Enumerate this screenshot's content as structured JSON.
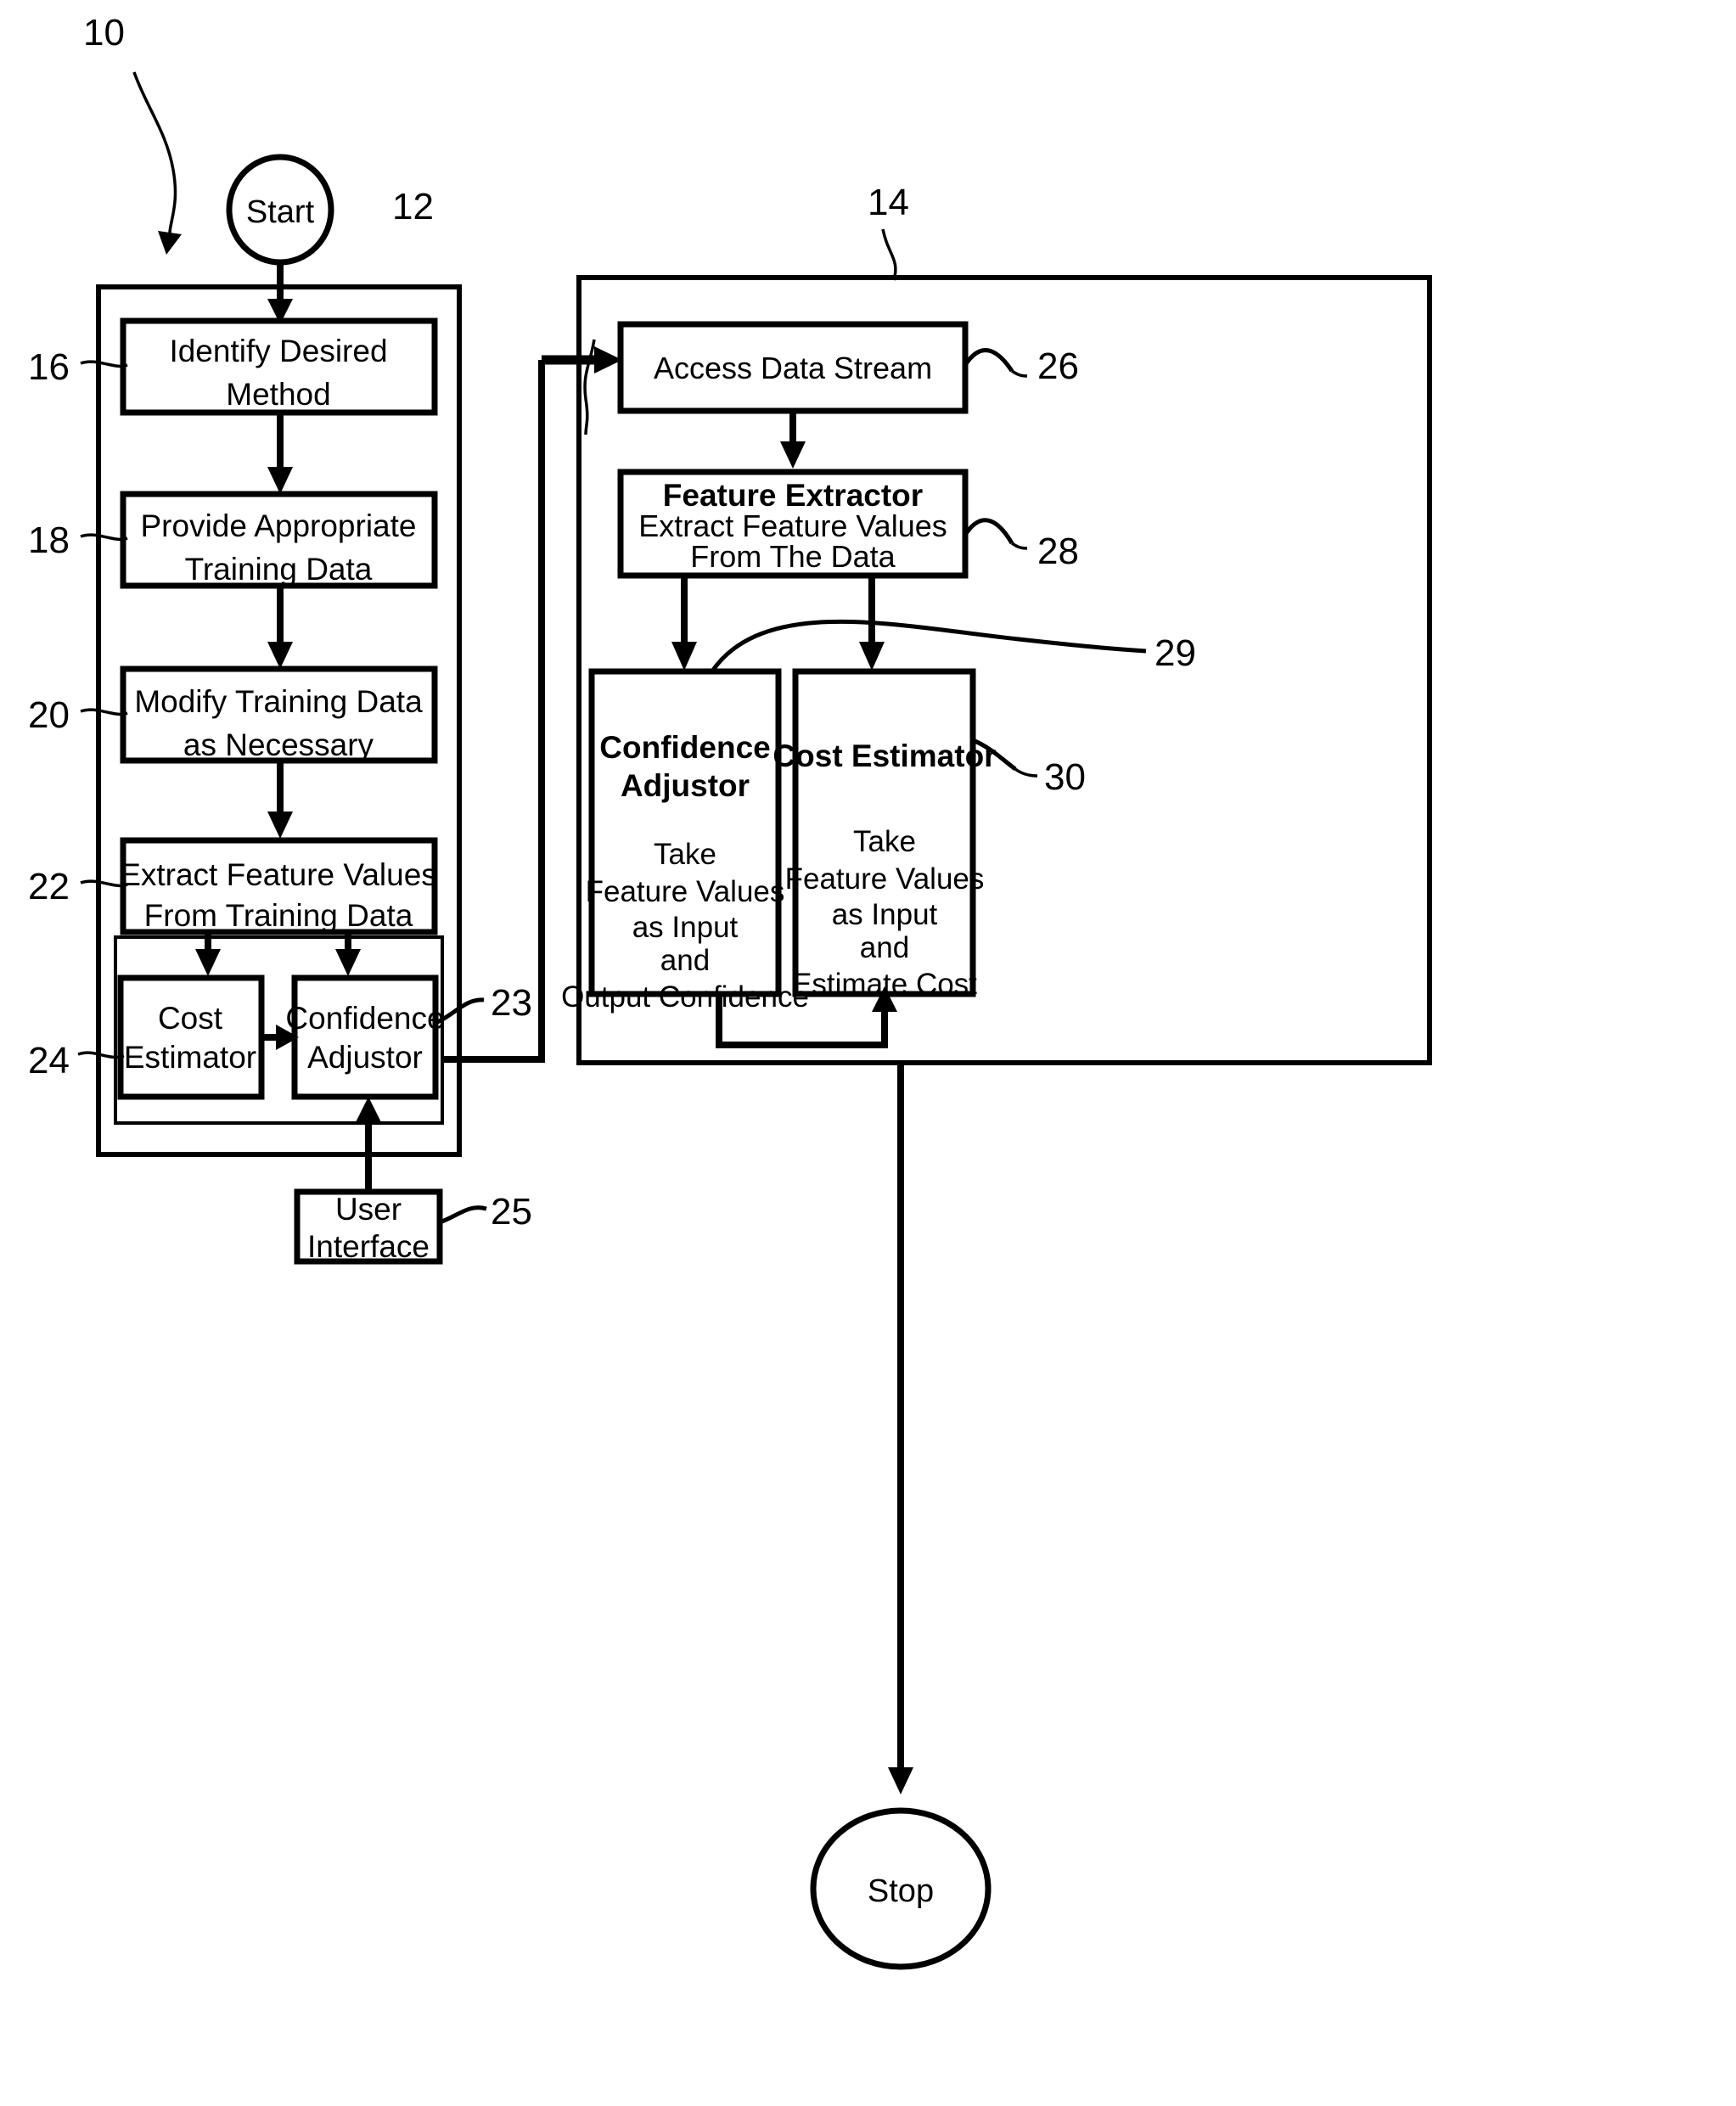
{
  "figure": {
    "type": "patent-flowchart",
    "figure_ref": "10",
    "background_color": "#ffffff",
    "line_color": "#000000"
  },
  "terminators": {
    "start": "Start",
    "stop": "Stop"
  },
  "reference_numerals": {
    "figure": "10",
    "training_panel": "12",
    "runtime_panel": "14",
    "identify_method": "16",
    "provide_training_data": "18",
    "modify_training_data": "20",
    "extract_feature_values": "22",
    "trained_models_group": "23",
    "cost_estimator_training": "24",
    "user_interface": "25",
    "access_data_stream": "26",
    "feature_extractor": "28",
    "feature_values_path": "29",
    "cost_estimator_runtime": "30"
  },
  "training_panel": {
    "ref": "12",
    "steps": [
      {
        "ref": "16",
        "line1": "Identify Desired",
        "line2": "Method"
      },
      {
        "ref": "18",
        "line1": "Provide Appropriate",
        "line2": "Training Data"
      },
      {
        "ref": "20",
        "line1": "Modify Training Data",
        "line2": "as Necessary"
      },
      {
        "ref": "22",
        "line1": "Extract Feature Values",
        "line2": "From Training Data"
      }
    ],
    "inner_group": {
      "ref": "23",
      "modules": [
        {
          "ref": "24",
          "line1": "Cost",
          "line2": "Estimator"
        },
        {
          "ref": "23",
          "line1": "Confidence",
          "line2": "Adjustor"
        }
      ]
    },
    "user_interface": {
      "ref": "25",
      "line1": "User",
      "line2": "Interface"
    }
  },
  "runtime_panel": {
    "ref": "14",
    "access_data_stream": {
      "ref": "26",
      "label": "Access Data Stream"
    },
    "feature_extractor": {
      "ref": "28",
      "title": "Feature Extractor",
      "line1": "Extract Feature Values",
      "line2": "From The Data"
    },
    "confidence_adjustor": {
      "title_line1": "Confidence",
      "title_line2": "Adjustor",
      "body": [
        "Take",
        "Feature Values",
        "as Input",
        "and",
        "Output Confidence"
      ]
    },
    "cost_estimator": {
      "ref": "30",
      "title": "Cost Estimator",
      "body": [
        "Take",
        "Feature Values",
        "as Input",
        "and",
        "Estimate Cost"
      ]
    },
    "feature_values_path_ref": "29"
  }
}
